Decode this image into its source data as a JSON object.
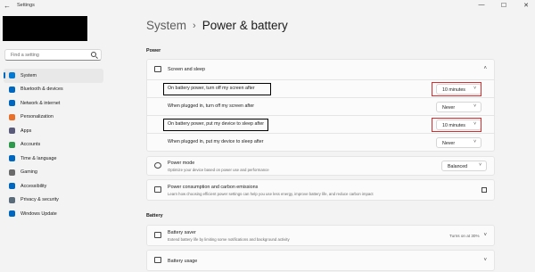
{
  "window": {
    "back_glyph": "←",
    "title": "Settings",
    "minimize": "—",
    "maximize": "☐",
    "close": "✕"
  },
  "search": {
    "placeholder": "Find a setting"
  },
  "sidebar": {
    "items": [
      {
        "label": "System",
        "icon": "system-icon",
        "color": "#0078d4",
        "active": true
      },
      {
        "label": "Bluetooth & devices",
        "icon": "bluetooth-icon",
        "color": "#0067c0"
      },
      {
        "label": "Network & internet",
        "icon": "network-icon",
        "color": "#0067c0"
      },
      {
        "label": "Personalization",
        "icon": "personalization-icon",
        "color": "#e8702a"
      },
      {
        "label": "Apps",
        "icon": "apps-icon",
        "color": "#5a5a7a"
      },
      {
        "label": "Accounts",
        "icon": "accounts-icon",
        "color": "#2e9a4c"
      },
      {
        "label": "Time & language",
        "icon": "time-language-icon",
        "color": "#0067c0"
      },
      {
        "label": "Gaming",
        "icon": "gaming-icon",
        "color": "#6b6b6b"
      },
      {
        "label": "Accessibility",
        "icon": "accessibility-icon",
        "color": "#0067c0"
      },
      {
        "label": "Privacy & security",
        "icon": "privacy-icon",
        "color": "#5a6b7a"
      },
      {
        "label": "Windows Update",
        "icon": "windows-update-icon",
        "color": "#0067c0"
      }
    ]
  },
  "breadcrumb": {
    "parent": "System",
    "separator": "›",
    "current": "Power & battery"
  },
  "power": {
    "section_title": "Power",
    "screen_sleep": {
      "title": "Screen and sleep",
      "collapse_glyph": "˄",
      "rows": [
        {
          "label": "On battery power, turn off my screen after",
          "value": "10 minutes",
          "highlighted": true
        },
        {
          "label": "When plugged in, turn off my screen after",
          "value": "Never",
          "highlighted": false
        },
        {
          "label": "On battery power, put my device to sleep after",
          "value": "10 minutes",
          "highlighted": true
        },
        {
          "label": "When plugged in, put my device to sleep after",
          "value": "Never",
          "highlighted": false
        }
      ]
    },
    "power_mode": {
      "title": "Power mode",
      "subtitle": "Optimize your device based on power use and performance",
      "value": "Balanced"
    },
    "consumption": {
      "title": "Power consumption and carbon emissions",
      "subtitle": "Learn how choosing efficient power settings can help you use less energy, improve battery life, and reduce carbon impact"
    }
  },
  "battery": {
    "section_title": "Battery",
    "saver": {
      "title": "Battery saver",
      "subtitle": "Extend battery life by limiting some notifications and background activity",
      "status": "Turns on at 30%",
      "chevron": "˅"
    },
    "usage": {
      "title": "Battery usage",
      "chevron": "˅"
    }
  },
  "dropdown_chevron": "˅",
  "colors": {
    "accent": "#0067c0",
    "highlight_red": "#d32f2f"
  }
}
